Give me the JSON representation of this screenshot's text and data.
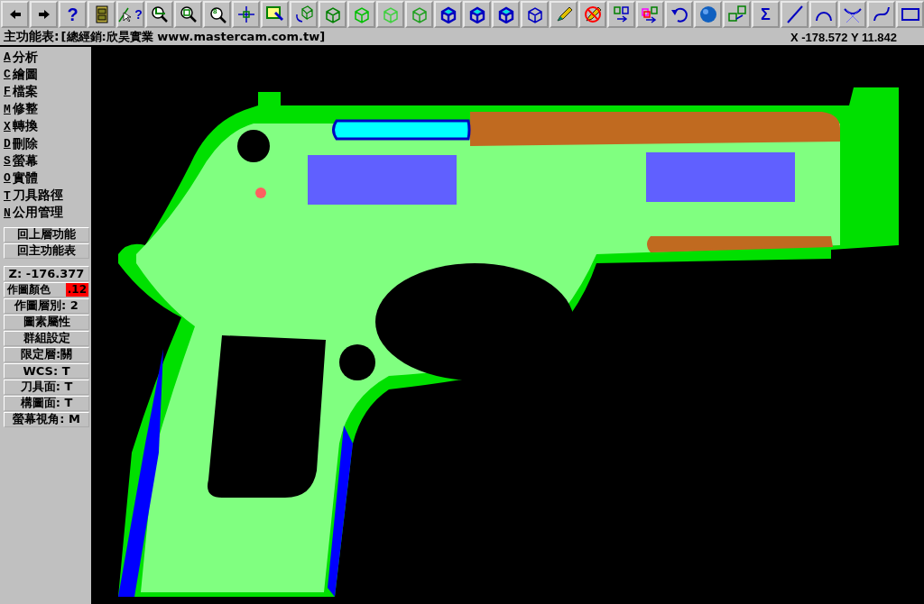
{
  "toolbar": [
    {
      "kind": "left"
    },
    {
      "kind": "right"
    },
    {
      "kind": "help",
      "glyph": "?"
    },
    {
      "kind": "cabinet"
    },
    {
      "kind": "pointer-help",
      "glyph": "?"
    },
    {
      "kind": "zoom-window"
    },
    {
      "kind": "zoom-fit"
    },
    {
      "kind": "zoom-8",
      "glyph": "8"
    },
    {
      "kind": "pan"
    },
    {
      "kind": "paint"
    },
    {
      "kind": "rotate-cube"
    },
    {
      "kind": "cube",
      "color": "#008000"
    },
    {
      "kind": "cube",
      "color": "#00c000"
    },
    {
      "kind": "cube",
      "color": "#40d040"
    },
    {
      "kind": "cube",
      "color": "#20a020"
    },
    {
      "kind": "cube-filled",
      "color": "#0000c0"
    },
    {
      "kind": "cube-filled",
      "color": "#0000c0"
    },
    {
      "kind": "cube-filled",
      "color": "#0000c0"
    },
    {
      "kind": "cube",
      "color": "#0000c0"
    },
    {
      "kind": "pencil"
    },
    {
      "kind": "no-pencil"
    },
    {
      "kind": "move"
    },
    {
      "kind": "copy"
    },
    {
      "kind": "undo"
    },
    {
      "kind": "sphere"
    },
    {
      "kind": "cubes"
    },
    {
      "kind": "sigma",
      "glyph": "Σ"
    },
    {
      "kind": "line"
    },
    {
      "kind": "arc"
    },
    {
      "kind": "fillet"
    },
    {
      "kind": "spline"
    },
    {
      "kind": "rect"
    }
  ],
  "prompt": {
    "label": "主功能表:",
    "text": "[總經銷:欣昊實業 www.mastercam.com.tw]",
    "coords": "X -178.572  Y 11.842"
  },
  "menu": [
    {
      "key": "A",
      "label": "分析"
    },
    {
      "key": "C",
      "label": "繪圖"
    },
    {
      "key": "F",
      "label": "檔案"
    },
    {
      "key": "M",
      "label": "修整"
    },
    {
      "key": "X",
      "label": "轉換"
    },
    {
      "key": "D",
      "label": "刪除"
    },
    {
      "key": "S",
      "label": "螢幕"
    },
    {
      "key": "O",
      "label": "實體"
    },
    {
      "key": "T",
      "label": "刀具路徑"
    },
    {
      "key": "N",
      "label": "公用管理"
    }
  ],
  "nav_buttons": [
    "回上層功能",
    "回主功能表"
  ],
  "settings": [
    {
      "kind": "plain",
      "label": "Z: -176.377"
    },
    {
      "kind": "color",
      "label": "作圖顏色",
      "value": ".12",
      "color": "#ff0000"
    },
    {
      "kind": "plain",
      "label": "作圖層別: 2"
    },
    {
      "kind": "plain",
      "label": "圖素屬性"
    },
    {
      "kind": "plain",
      "label": "群組設定"
    },
    {
      "kind": "plain",
      "label": "限定層:關"
    },
    {
      "kind": "plain",
      "label": "WCS:  T"
    },
    {
      "kind": "plain",
      "label": "刀具面: T"
    },
    {
      "kind": "plain",
      "label": "構圖面: T"
    },
    {
      "kind": "plain",
      "label": "螢幕視角: M"
    }
  ]
}
